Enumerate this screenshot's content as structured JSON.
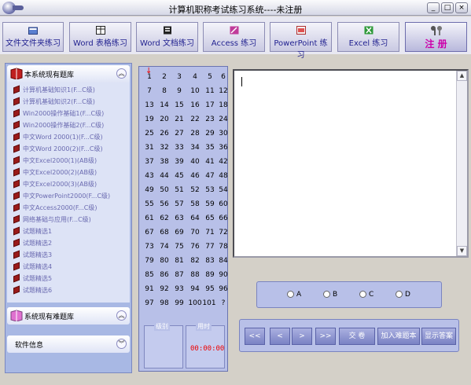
{
  "window": {
    "title": "计算机职称考试练习系统----未注册",
    "min": "_",
    "max": "□",
    "close": "×"
  },
  "toolbar": [
    {
      "label": "文件文件夹练习"
    },
    {
      "label": "Word 表格练习"
    },
    {
      "label": "Word 文档练习"
    },
    {
      "label": "Access 练习"
    },
    {
      "label": "PowerPoint 练习"
    },
    {
      "label": "Excel 练习"
    }
  ],
  "register_label": "注 册",
  "left": {
    "owned_title": "本系统现有题库",
    "items": [
      "计算机基础知识1(F...C级)",
      "计算机基础知识2(F...C级)",
      "Win2000操作基础1(F...C级)",
      "Win2000操作基础2(F...C级)",
      "中文Word 2000(1)(F...C级)",
      "中文Word 2000(2)(F...C级)",
      "中文Excel2000(1)(AB级)",
      "中文Excel2000(2)(AB级)",
      "中文Excel2000(3)(AB级)",
      "中文PowerPoint2000(F...C级)",
      "中文Access2000(F...C级)",
      "网络基础与应用(F...C级)",
      "试题精选1",
      "试题精选2",
      "试题精选3",
      "试题精选4",
      "试题精选5",
      "试题精选6"
    ],
    "hard_title": "系统现有难题库",
    "info_title": "软件信息"
  },
  "questions": [
    "1",
    "2",
    "3",
    "4",
    "5",
    "6",
    "7",
    "8",
    "9",
    "10",
    "11",
    "12",
    "13",
    "14",
    "15",
    "16",
    "17",
    "18",
    "19",
    "20",
    "21",
    "22",
    "23",
    "24",
    "25",
    "26",
    "27",
    "28",
    "29",
    "30",
    "31",
    "32",
    "33",
    "34",
    "35",
    "36",
    "37",
    "38",
    "39",
    "40",
    "41",
    "42",
    "43",
    "44",
    "45",
    "46",
    "47",
    "48",
    "49",
    "50",
    "51",
    "52",
    "53",
    "54",
    "55",
    "56",
    "57",
    "58",
    "59",
    "60",
    "61",
    "62",
    "63",
    "64",
    "65",
    "66",
    "67",
    "68",
    "69",
    "70",
    "71",
    "72",
    "73",
    "74",
    "75",
    "76",
    "77",
    "78",
    "79",
    "80",
    "81",
    "82",
    "83",
    "84",
    "85",
    "86",
    "87",
    "88",
    "89",
    "90",
    "91",
    "92",
    "93",
    "94",
    "95",
    "96",
    "97",
    "98",
    "99",
    "100",
    "101",
    "?"
  ],
  "grade_label": "级别",
  "time_label": "用时",
  "timer": "00:00:00",
  "options": [
    "A",
    "B",
    "C",
    "D"
  ],
  "nav": [
    "<<",
    "<",
    ">",
    ">>",
    "交 卷",
    "加入难题本",
    "显示答案"
  ],
  "colors": {
    "register_text": "#cc00aa",
    "timer": "#ee0000",
    "toolbar_text": "#1f1f8f"
  }
}
